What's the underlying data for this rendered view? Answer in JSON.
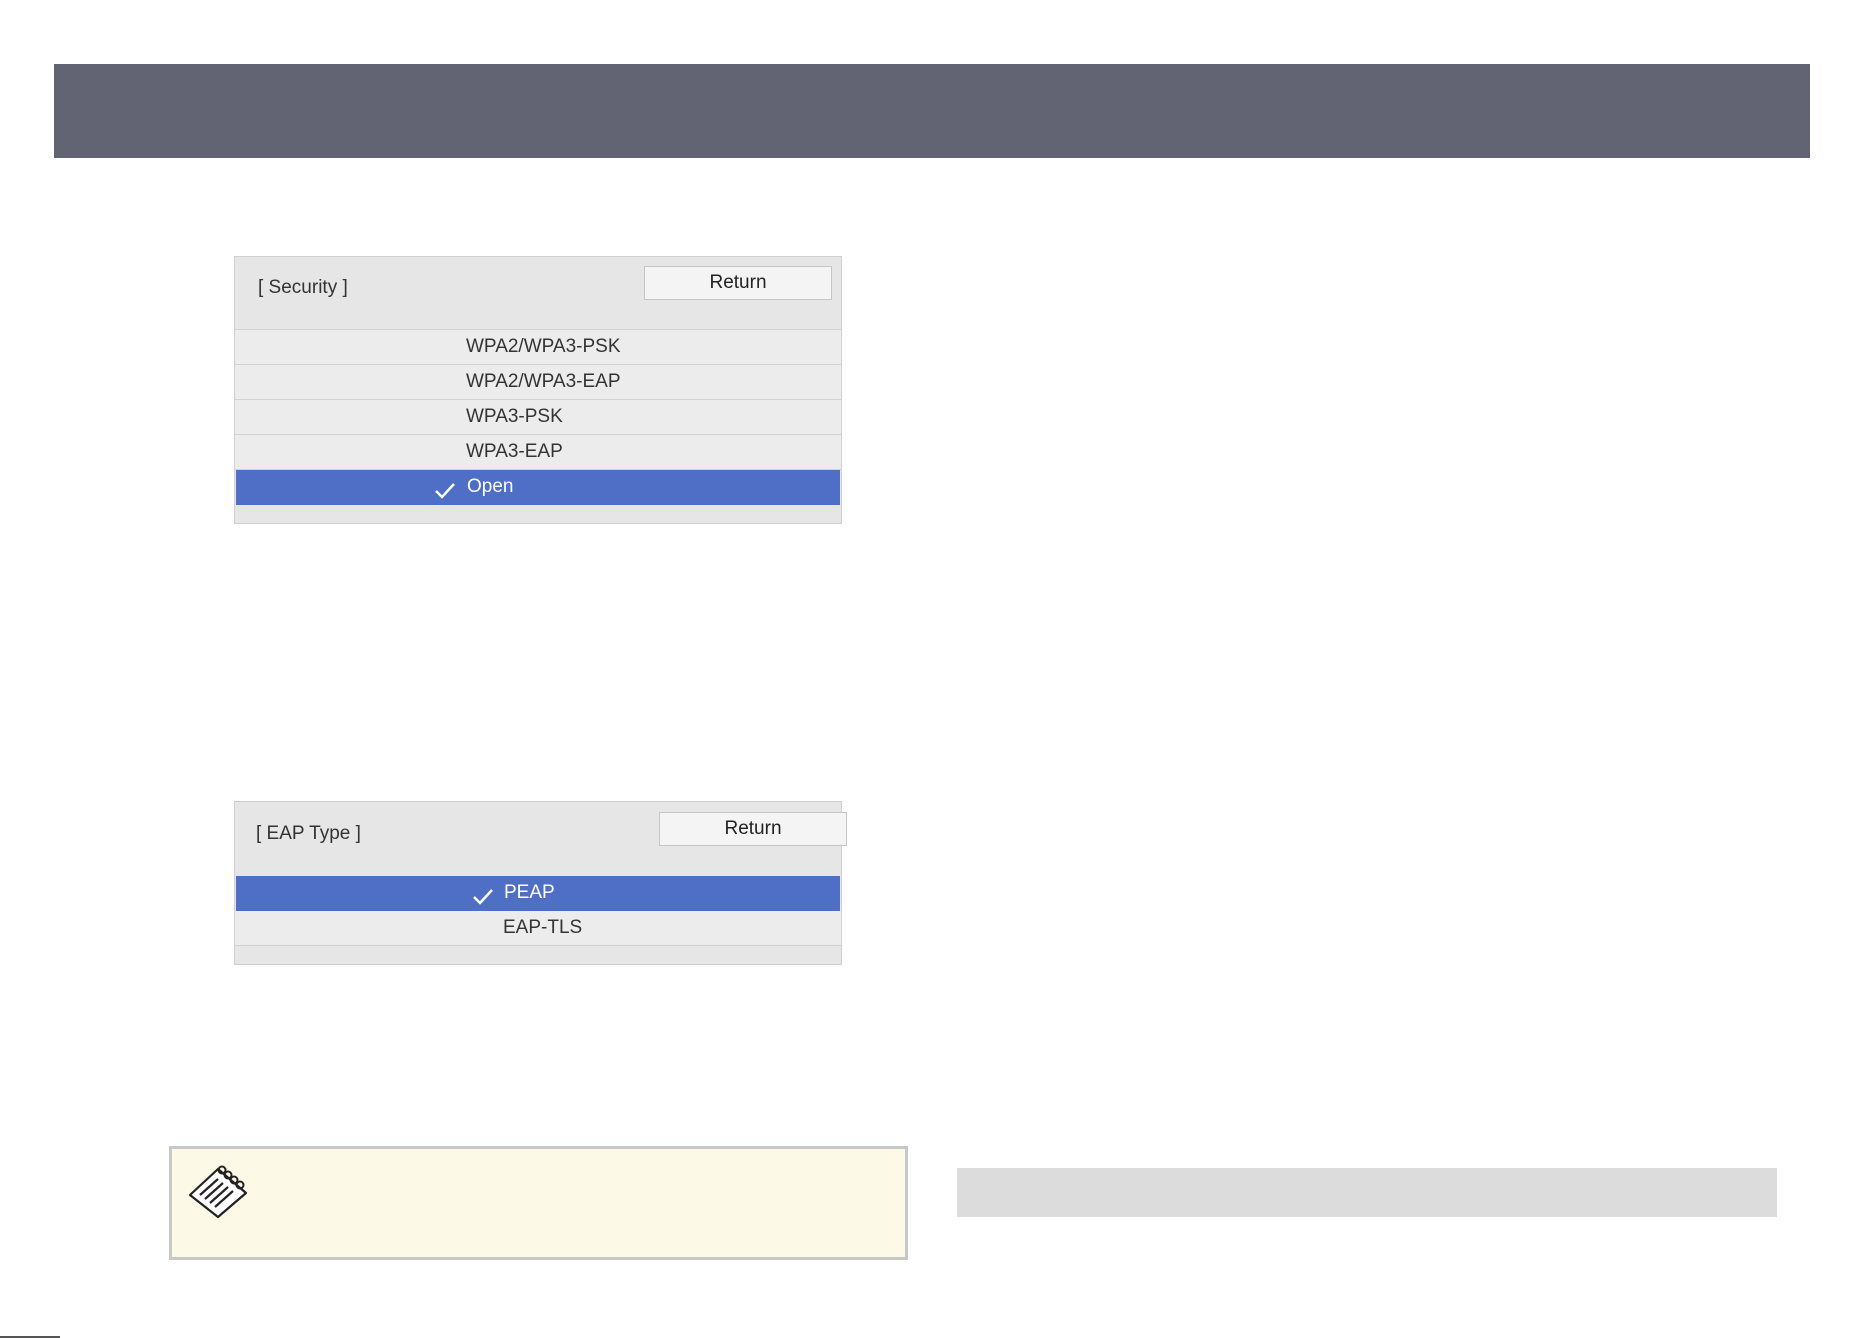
{
  "security_dialog": {
    "title": "[ Security ]",
    "return_label": "Return",
    "options": [
      {
        "label": "WPA2/WPA3-PSK",
        "selected": false
      },
      {
        "label": "WPA2/WPA3-EAP",
        "selected": false
      },
      {
        "label": "WPA3-PSK",
        "selected": false
      },
      {
        "label": "WPA3-EAP",
        "selected": false
      },
      {
        "label": "Open",
        "selected": true
      }
    ]
  },
  "eap_dialog": {
    "title": "[ EAP Type ]",
    "return_label": "Return",
    "options": [
      {
        "label": "PEAP",
        "selected": true
      },
      {
        "label": "EAP-TLS",
        "selected": false
      }
    ]
  },
  "note": {
    "icon": "note-pad-icon"
  },
  "colors": {
    "header": "#626474",
    "selected": "#4f6fc7",
    "note_bg": "#fdf9e7"
  }
}
